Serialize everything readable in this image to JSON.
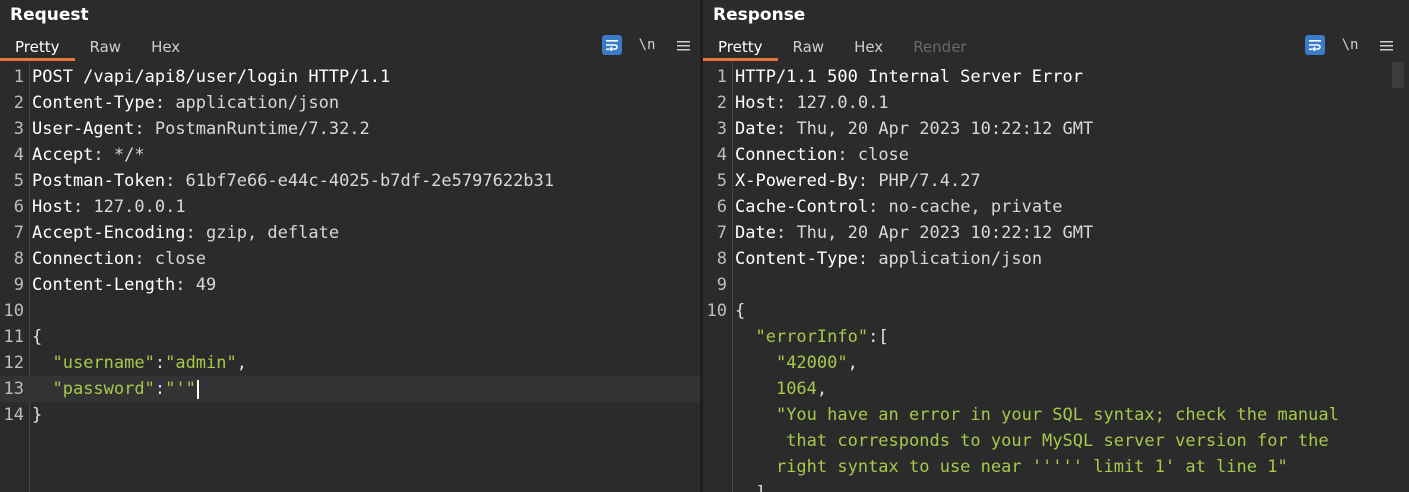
{
  "layout_toggles": [
    {
      "name": "side-by-side-layout-icon",
      "active": true
    },
    {
      "name": "stacked-layout-icon",
      "active": false
    },
    {
      "name": "single-pane-layout-icon",
      "active": false
    }
  ],
  "request": {
    "title": "Request",
    "tabs": [
      "Pretty",
      "Raw",
      "Hex"
    ],
    "active_tab": "Pretty",
    "tools": {
      "newline_label": "\\n"
    },
    "lines": [
      {
        "n": "1",
        "header": "POST /vapi/api8/user/login HTTP/1.1",
        "value": ""
      },
      {
        "n": "2",
        "header": "Content-Type",
        "value": "application/json"
      },
      {
        "n": "3",
        "header": "User-Agent",
        "value": "PostmanRuntime/7.32.2"
      },
      {
        "n": "4",
        "header": "Accept",
        "value": "*/*"
      },
      {
        "n": "5",
        "header": "Postman-Token",
        "value": "61bf7e66-e44c-4025-b7df-2e5797622b31"
      },
      {
        "n": "6",
        "header": "Host",
        "value": "127.0.0.1"
      },
      {
        "n": "7",
        "header": "Accept-Encoding",
        "value": "gzip, deflate"
      },
      {
        "n": "8",
        "header": "Connection",
        "value": "close"
      },
      {
        "n": "9",
        "header": "Content-Length",
        "value": "49"
      },
      {
        "n": "10",
        "header": "",
        "value": ""
      },
      {
        "n": "11",
        "header": "",
        "value": "{"
      },
      {
        "n": "12",
        "key": "\"username\"",
        "sep": ":",
        "val": "\"admin\"",
        "tail": ","
      },
      {
        "n": "13",
        "key": "\"password\"",
        "sep": ":",
        "val": "\"'\"",
        "tail": ""
      },
      {
        "n": "14",
        "header": "",
        "value": "}"
      }
    ]
  },
  "response": {
    "title": "Response",
    "tabs": [
      "Pretty",
      "Raw",
      "Hex",
      "Render"
    ],
    "active_tab": "Pretty",
    "tools": {
      "newline_label": "\\n"
    },
    "lines": [
      {
        "n": "1",
        "header": "HTTP/1.1 500 Internal Server Error",
        "value": ""
      },
      {
        "n": "2",
        "header": "Host",
        "value": "127.0.0.1"
      },
      {
        "n": "3",
        "header": "Date",
        "value": "Thu, 20 Apr 2023 10:22:12 GMT"
      },
      {
        "n": "4",
        "header": "Connection",
        "value": "close"
      },
      {
        "n": "5",
        "header": "X-Powered-By",
        "value": "PHP/7.4.27"
      },
      {
        "n": "6",
        "header": "Cache-Control",
        "value": "no-cache, private"
      },
      {
        "n": "7",
        "header": "Date",
        "value": "Thu, 20 Apr 2023 10:22:12 GMT"
      },
      {
        "n": "8",
        "header": "Content-Type",
        "value": "application/json"
      },
      {
        "n": "9",
        "header": "",
        "value": ""
      },
      {
        "n": "10",
        "header": "",
        "value": "{"
      }
    ],
    "body_lines": [
      {
        "indent": "  ",
        "key": "\"errorInfo\"",
        "sep": ":",
        "tail": "["
      },
      {
        "indent": "    ",
        "str": "\"42000\"",
        "tail": ","
      },
      {
        "indent": "    ",
        "num": "1064",
        "tail": ","
      },
      {
        "indent": "    ",
        "str": "\"You have an error in your SQL syntax; check the manual",
        "tail": ""
      },
      {
        "indent": "     ",
        "str": "that corresponds to your MySQL server version for the",
        "tail": ""
      },
      {
        "indent": "    ",
        "str": "right syntax to use near ''''' limit 1' at line 1\"",
        "tail": ""
      },
      {
        "indent": "  ",
        "str": "",
        "tail": "],"
      }
    ]
  }
}
